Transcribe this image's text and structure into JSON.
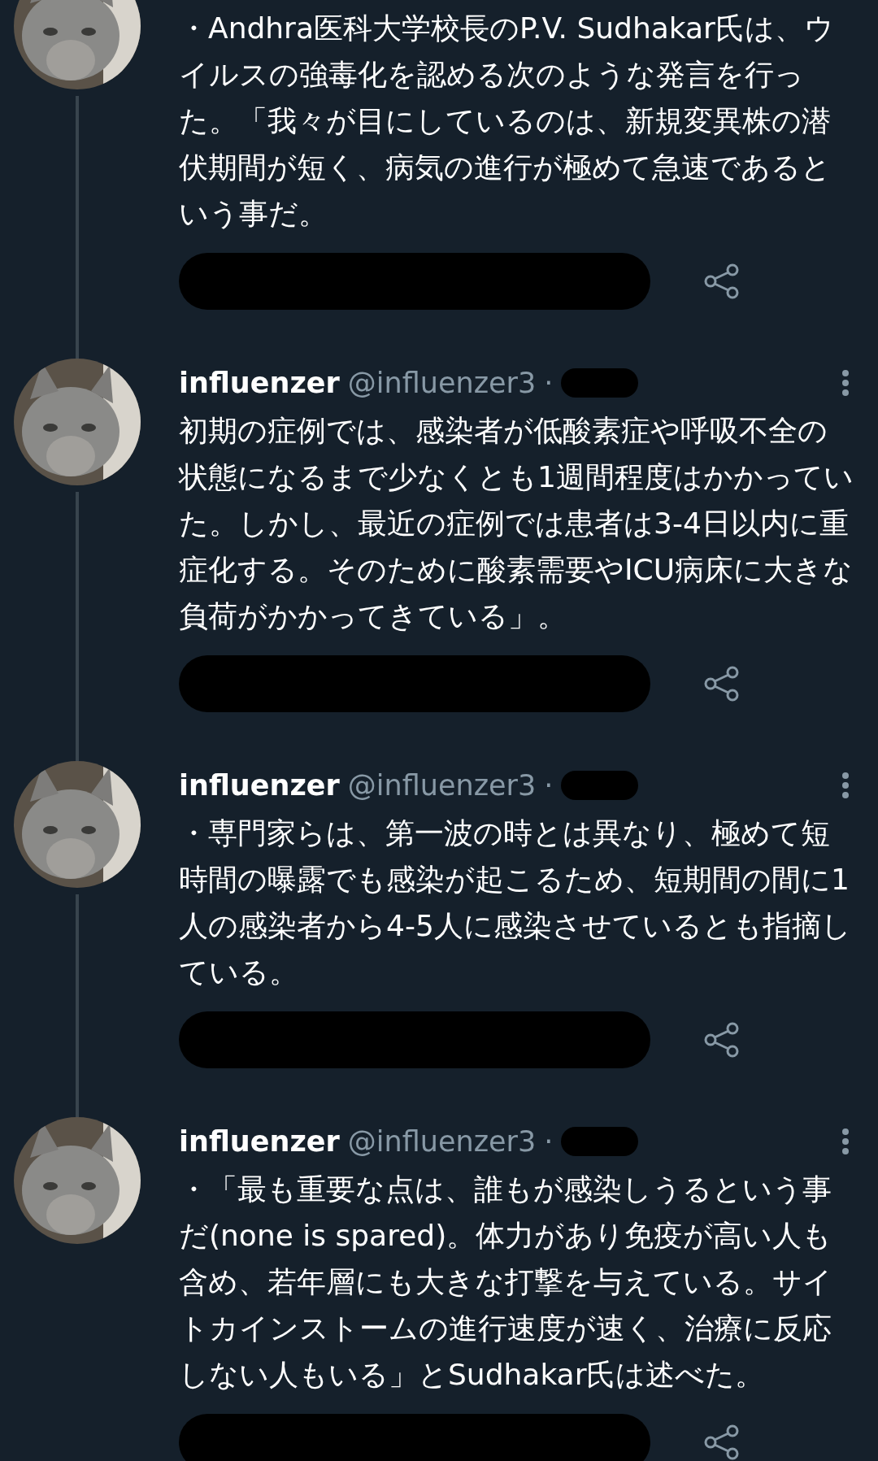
{
  "tweets": [
    {
      "text": "・Andhra医科大学校長のP.V. Sudhakar氏は、ウイルスの強毒化を認める次のような発言を行った。「我々が目にしているのは、新規変異株の潜伏期間が短く、病気の進行が極めて急速であるという事だ。"
    },
    {
      "author": {
        "name": "influenzer",
        "handle": "@influenzer3",
        "separator": "·"
      },
      "text": "初期の症例では、感染者が低酸素症や呼吸不全の状態になるまで少なくとも1週間程度はかかっていた。しかし、最近の症例では患者は3-4日以内に重症化する。そのために酸素需要やICU病床に大きな負荷がかかってきている」。"
    },
    {
      "author": {
        "name": "influenzer",
        "handle": "@influenzer3",
        "separator": "·"
      },
      "text": "・専門家らは、第一波の時とは異なり、極めて短時間の曝露でも感染が起こるため、短期間の間に1人の感染者から4-5人に感染させているとも指摘している。"
    },
    {
      "author": {
        "name": "influenzer",
        "handle": "@influenzer3",
        "separator": "·"
      },
      "text": "・「最も重要な点は、誰もが感染しうるという事だ(none is spared)。体力があり免疫が高い人も含め、若年層にも大きな打撃を与えている。サイトカインストームの進行速度が速く、治療に反応しない人もいる」とSudhakar氏は述べた。"
    }
  ]
}
